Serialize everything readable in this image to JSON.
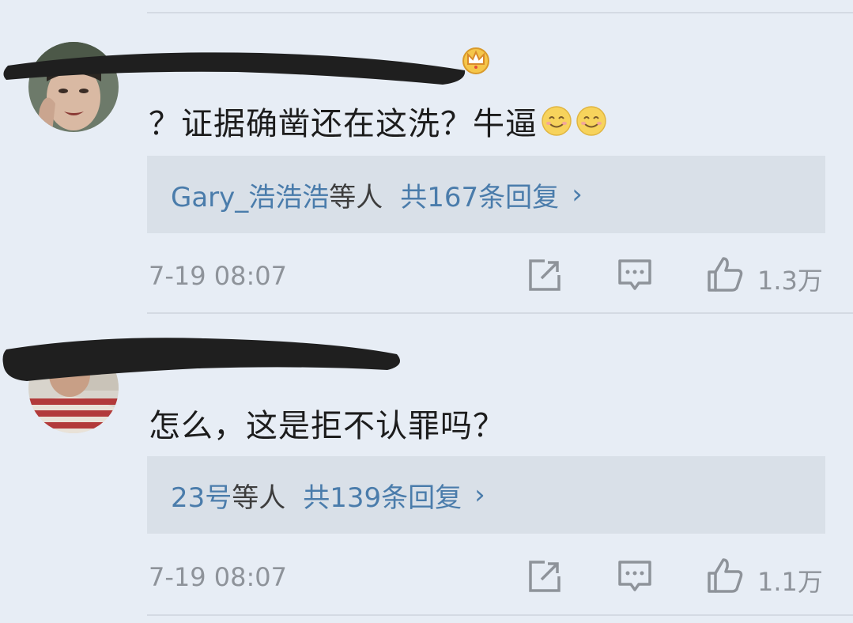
{
  "comments": [
    {
      "username": "",
      "text": "？证据确凿还在这洗？牛逼",
      "emojis": [
        "smile-emoji",
        "smile-emoji"
      ],
      "reply_names": "Gary_浩浩浩",
      "reply_mid": "等人",
      "reply_count": "共167条回复",
      "reply_chevron": "›",
      "time": "7-19 08:07",
      "likes": "1.3万"
    },
    {
      "username": "",
      "text": "怎么，这是拒不认罪吗？",
      "emojis": [],
      "reply_names": "23号",
      "reply_mid": "等人",
      "reply_count": "共139条回复",
      "reply_chevron": "›",
      "time": "7-19 08:07",
      "likes": "1.1万"
    }
  ],
  "icons": {
    "share": "share-icon",
    "comment": "comment-icon",
    "like": "thumbs-up-icon",
    "badge": "crown-badge-icon"
  },
  "colors": {
    "background": "#e7edf5",
    "reply_box": "#d9e0e8",
    "link": "#4a7cab",
    "meta": "#8e939a",
    "username": "#e8874a"
  }
}
